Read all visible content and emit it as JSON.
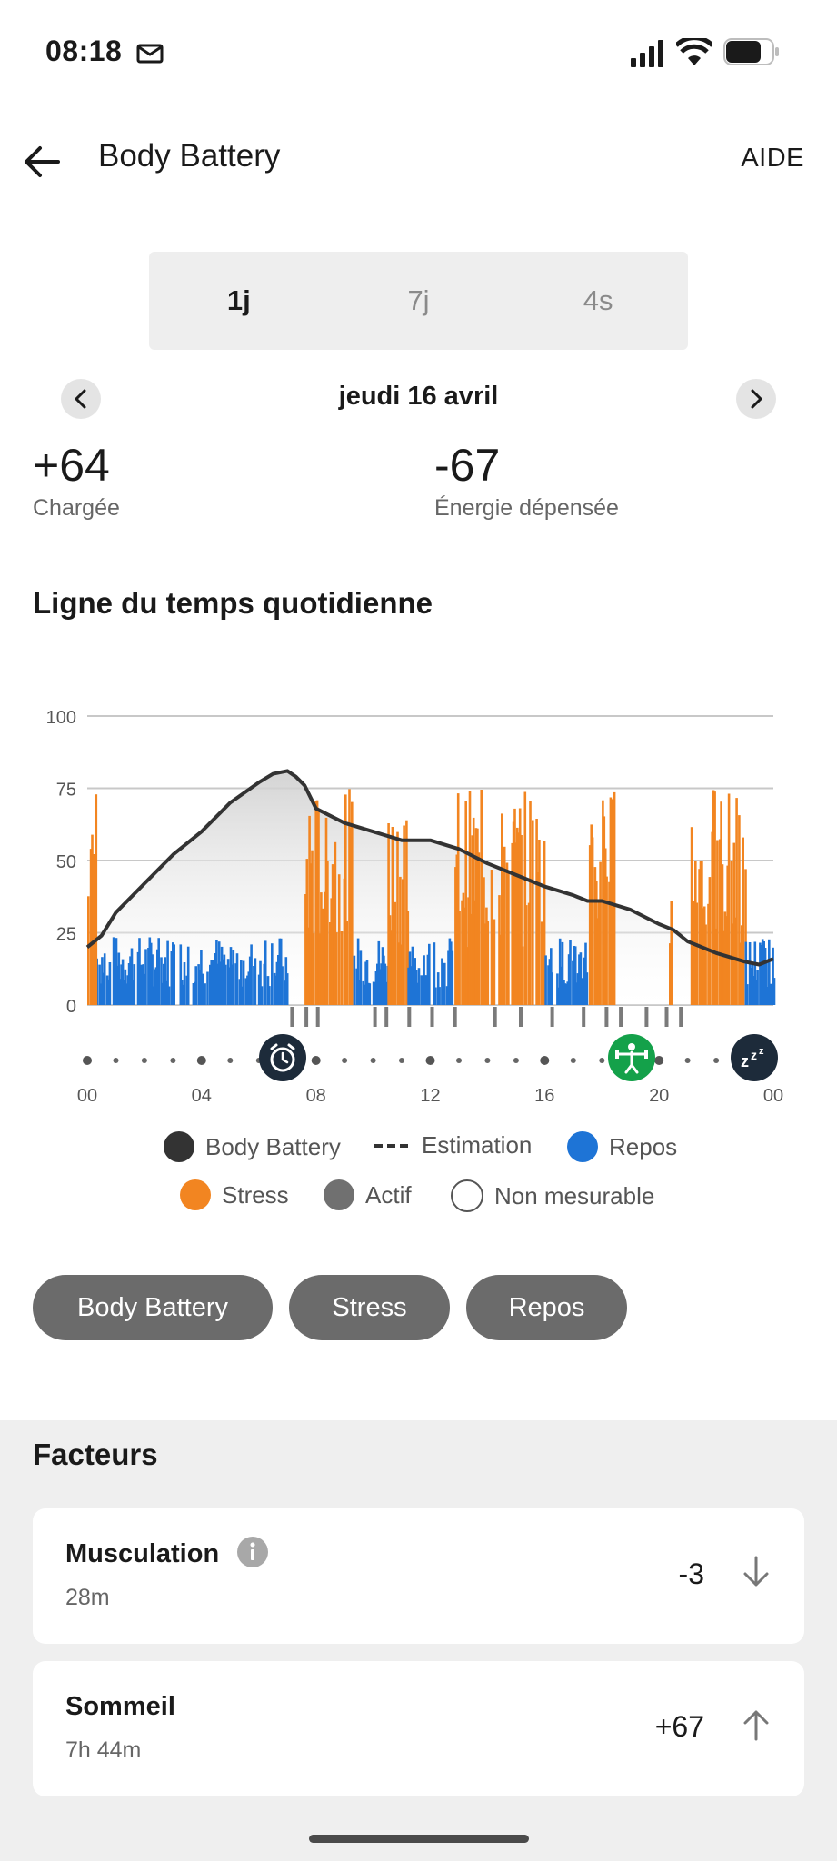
{
  "status_bar": {
    "time": "08:18"
  },
  "header": {
    "title": "Body Battery",
    "help": "AIDE"
  },
  "tabs": [
    {
      "label": "1j",
      "active": true
    },
    {
      "label": "7j",
      "active": false
    },
    {
      "label": "4s",
      "active": false
    }
  ],
  "date_nav": {
    "date": "jeudi 16 avril"
  },
  "stats": {
    "charged": {
      "value": "+64",
      "label": "Chargée"
    },
    "spent": {
      "value": "-67",
      "label": "Énergie dépensée"
    }
  },
  "timeline": {
    "title": "Ligne du temps quotidienne",
    "legend": [
      {
        "label": "Body Battery",
        "color": "#333333"
      },
      {
        "label": "Estimation",
        "color": "#333333"
      },
      {
        "label": "Repos",
        "color": "#1e74d6"
      },
      {
        "label": "Stress",
        "color": "#f28521"
      },
      {
        "label": "Actif",
        "color": "#707070"
      },
      {
        "label": "Non mesurable",
        "color": "#ffffff"
      }
    ],
    "markers": [
      "alarm-icon",
      "strength-training-icon",
      "sleep-icon"
    ]
  },
  "filters": [
    "Body Battery",
    "Stress",
    "Repos"
  ],
  "factors": {
    "title": "Facteurs",
    "items": [
      {
        "name": "Musculation",
        "duration": "28m",
        "value": "-3",
        "direction": "down"
      },
      {
        "name": "Sommeil",
        "duration": "7h 44m",
        "value": "+67",
        "direction": "up"
      }
    ]
  },
  "chart_data": {
    "type": "line",
    "x_ticks": [
      "00",
      "04",
      "08",
      "12",
      "16",
      "20",
      "00"
    ],
    "y_ticks": [
      0,
      25,
      50,
      75,
      100
    ],
    "ylim": [
      0,
      100
    ],
    "xlim_hours": [
      0,
      24
    ],
    "series": [
      {
        "name": "Body Battery",
        "x_hours": [
          0,
          0.5,
          1,
          2,
          3,
          4,
          5,
          6,
          6.5,
          7,
          7.3,
          7.6,
          8,
          9,
          10,
          11,
          12,
          13,
          14,
          15,
          16,
          17,
          17.5,
          18,
          19,
          20,
          20.5,
          21,
          22,
          23,
          23.5,
          24
        ],
        "values": [
          20,
          24,
          32,
          42,
          52,
          60,
          70,
          77,
          80,
          81,
          79,
          76,
          68,
          63,
          60,
          57,
          57,
          54,
          49,
          45,
          41,
          38,
          36,
          36,
          33,
          28,
          26,
          22,
          18,
          15,
          14,
          16
        ]
      }
    ],
    "bars": [
      {
        "series": "Repos",
        "from_hour": 0.3,
        "to_hour": 7.0
      },
      {
        "series": "Stress",
        "from_hour": 0,
        "to_hour": 0.3
      },
      {
        "series": "Stress",
        "from_hour": 7.6,
        "to_hour": 9.3
      },
      {
        "series": "Repos",
        "from_hour": 9.3,
        "to_hour": 10.5
      },
      {
        "series": "Stress",
        "from_hour": 10.5,
        "to_hour": 11.2
      },
      {
        "series": "Repos",
        "from_hour": 11.2,
        "to_hour": 12.8
      },
      {
        "series": "Stress",
        "from_hour": 12.8,
        "to_hour": 16.0
      },
      {
        "series": "Repos",
        "from_hour": 16.0,
        "to_hour": 17.5
      },
      {
        "series": "Stress",
        "from_hour": 17.5,
        "to_hour": 18.5
      },
      {
        "series": "Stress",
        "from_hour": 20.3,
        "to_hour": 20.4
      },
      {
        "series": "Stress",
        "from_hour": 21.1,
        "to_hour": 23.0
      },
      {
        "series": "Repos",
        "from_hour": 23.0,
        "to_hour": 24.0
      }
    ]
  }
}
